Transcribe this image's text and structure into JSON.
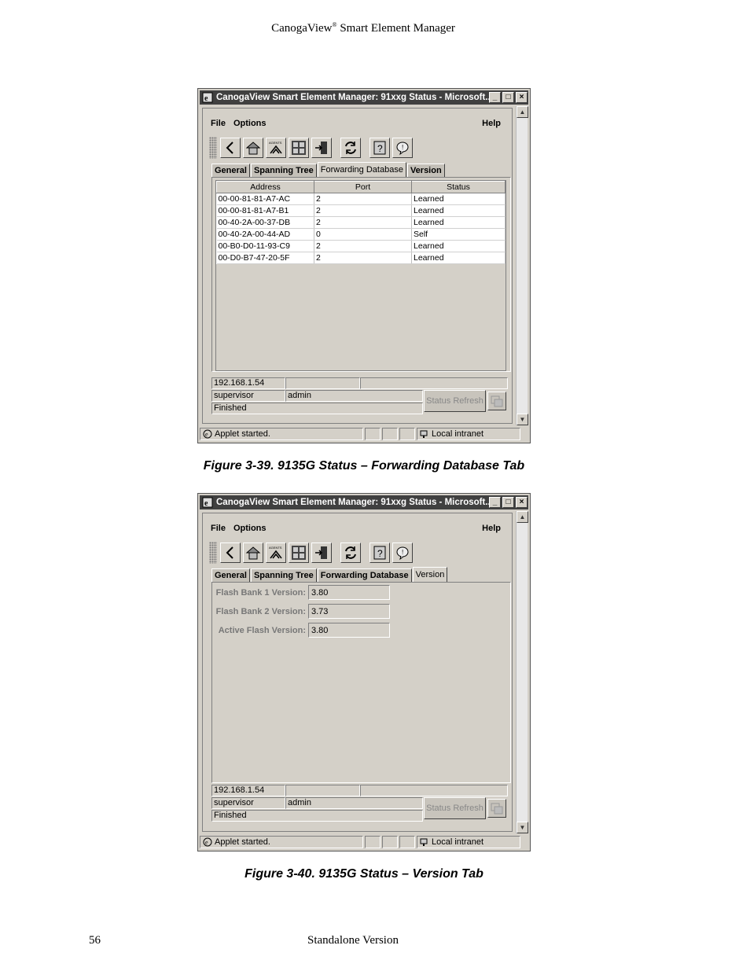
{
  "header": {
    "brand": "CanogaView",
    "reg": "®",
    "rest": " Smart Element Manager"
  },
  "footer": {
    "page_number": "56",
    "text": "Standalone Version"
  },
  "window": {
    "title": "CanogaView Smart Element Manager: 91xxg Status - Microsoft...",
    "menu": {
      "file": "File",
      "options": "Options",
      "help": "Help"
    },
    "tabs": [
      "General",
      "Spanning Tree",
      "Forwarding Database",
      "Version"
    ],
    "statusbar": {
      "applet": "Applet started.",
      "zone": "Local intranet"
    },
    "info": {
      "ip": "192.168.1.54",
      "user": "supervisor",
      "access": "admin",
      "state": "Finished",
      "refresh_label": "Status Refresh"
    },
    "toolbar_icons": [
      "back-icon",
      "home-icon",
      "agents-icon",
      "grid-icon",
      "exit-icon",
      "refresh-icon",
      "help-icon",
      "info-icon"
    ],
    "agents_label": "AGENTS"
  },
  "figure1": {
    "caption": "Figure 3-39. 9135G Status – Forwarding Database Tab",
    "columns": [
      "Address",
      "Port",
      "Status"
    ],
    "rows": [
      [
        "00-00-81-81-A7-AC",
        "2",
        "Learned"
      ],
      [
        "00-00-81-81-A7-B1",
        "2",
        "Learned"
      ],
      [
        "00-40-2A-00-37-DB",
        "2",
        "Learned"
      ],
      [
        "00-40-2A-00-44-AD",
        "0",
        "Self"
      ],
      [
        "00-B0-D0-11-93-C9",
        "2",
        "Learned"
      ],
      [
        "00-D0-B7-47-20-5F",
        "2",
        "Learned"
      ]
    ]
  },
  "figure2": {
    "caption": "Figure 3-40. 9135G Status – Version Tab",
    "fields": [
      {
        "label": "Flash Bank 1 Version:",
        "value": "3.80"
      },
      {
        "label": "Flash Bank 2 Version:",
        "value": "3.73"
      },
      {
        "label": "Active Flash Version:",
        "value": "3.80"
      }
    ]
  }
}
